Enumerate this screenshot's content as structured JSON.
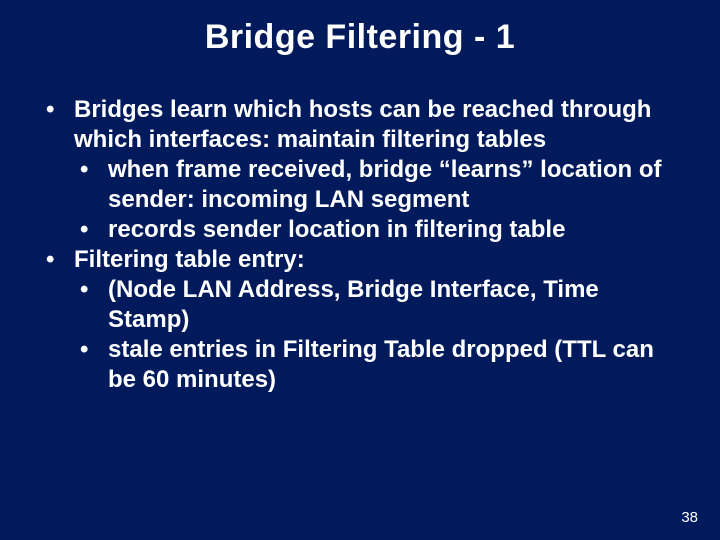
{
  "title": "Bridge Filtering - 1",
  "bullets": [
    {
      "text": "Bridges learn which hosts can be reached through which interfaces: maintain filtering tables",
      "sub": [
        "when frame received, bridge “learns” location of sender: incoming LAN segment",
        "records sender location in filtering table"
      ]
    },
    {
      "text": "Filtering table entry:",
      "sub": [
        "(Node LAN Address, Bridge Interface, Time Stamp)",
        "stale entries in Filtering Table dropped (TTL can be 60 minutes)"
      ]
    }
  ],
  "page_number": "38"
}
